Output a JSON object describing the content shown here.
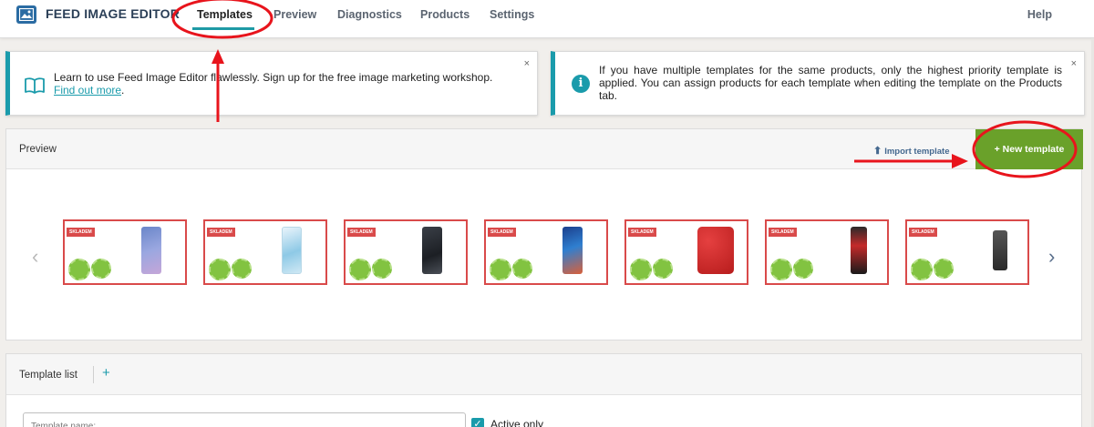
{
  "app": {
    "title": "FEED IMAGE EDITOR"
  },
  "nav": {
    "tabs": [
      {
        "label": "Templates"
      },
      {
        "label": "Preview"
      },
      {
        "label": "Diagnostics"
      },
      {
        "label": "Products"
      },
      {
        "label": "Settings"
      }
    ],
    "help": "Help"
  },
  "notices": {
    "workshop": {
      "text": "Learn to use Feed Image Editor flawlessly. Sign up for the free image marketing workshop.",
      "link": "Find out more",
      "link_suffix": ".",
      "close": "×"
    },
    "priority": {
      "text": "If you have multiple templates for the same products, only the highest priority template is applied. You can assign products for each template when editing the template on the Products tab.",
      "close": "×"
    }
  },
  "preview": {
    "title": "Preview",
    "import_label": "Import template",
    "new_template_label": "+ New template",
    "prev": "‹",
    "next": "›",
    "badge": "SKLADEM",
    "thumbnails": [
      {
        "phone": "galaxy-s10-lite"
      },
      {
        "phone": "galaxy-s20"
      },
      {
        "phone": "dark-smartphone"
      },
      {
        "phone": "galaxy-a20e"
      },
      {
        "phone": "red-senior-phones"
      },
      {
        "phone": "black-red-senior-phone"
      },
      {
        "phone": "senior-phone-dock"
      }
    ]
  },
  "template_list": {
    "title": "Template list",
    "add": "+",
    "name_placeholder": "Template name:",
    "active_only_label": "Active only"
  },
  "colors": {
    "accent": "#1a9bab",
    "primary_button": "#6aa12a",
    "thumbnail_border": "#d94a4a",
    "annotation": "#e8141c"
  }
}
